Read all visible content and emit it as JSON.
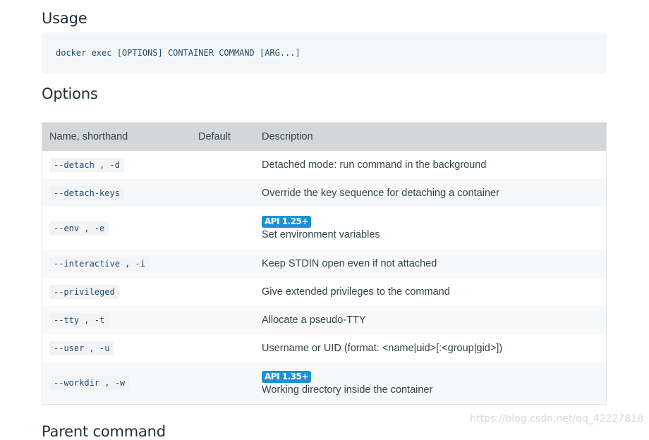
{
  "usage": {
    "heading": "Usage",
    "command": "docker exec [OPTIONS] CONTAINER COMMAND [ARG...]"
  },
  "options": {
    "heading": "Options",
    "columns": [
      "Name, shorthand",
      "Default",
      "Description"
    ],
    "rows": [
      {
        "name": "--detach , -d",
        "default": "",
        "badge": "",
        "description": "Detached mode: run command in the background"
      },
      {
        "name": "--detach-keys",
        "default": "",
        "badge": "",
        "description": "Override the key sequence for detaching a container"
      },
      {
        "name": "--env , -e",
        "default": "",
        "badge": "API 1.25+",
        "description": "Set environment variables"
      },
      {
        "name": "--interactive , -i",
        "default": "",
        "badge": "",
        "description": "Keep STDIN open even if not attached"
      },
      {
        "name": "--privileged",
        "default": "",
        "badge": "",
        "description": "Give extended privileges to the command"
      },
      {
        "name": "--tty , -t",
        "default": "",
        "badge": "",
        "description": "Allocate a pseudo-TTY"
      },
      {
        "name": "--user , -u",
        "default": "",
        "badge": "",
        "description": "Username or UID (format: <name|uid>[:<group|gid>])"
      },
      {
        "name": "--workdir , -w",
        "default": "",
        "badge": "API 1.35+",
        "description": "Working directory inside the container"
      }
    ]
  },
  "next_heading": "Parent command",
  "watermark": "https://blog.csdn.net/qq_42227818",
  "colors": {
    "badge": "#1f8fd3",
    "table_header": "#d4d7da",
    "code_text": "#1f4a6e"
  }
}
